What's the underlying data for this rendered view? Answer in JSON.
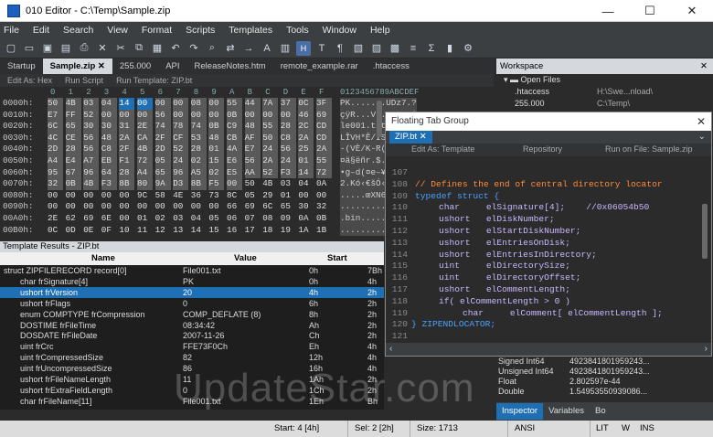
{
  "window": {
    "title": "010 Editor - C:\\Temp\\Sample.zip",
    "min": "—",
    "max": "☐",
    "close": "✕"
  },
  "menu": [
    "File",
    "Edit",
    "Search",
    "View",
    "Format",
    "Scripts",
    "Templates",
    "Tools",
    "Window",
    "Help"
  ],
  "tabs": [
    "Startup",
    "Sample.zip",
    "255.000",
    "API",
    "ReleaseNotes.htm",
    "remote_example.rar",
    ".htaccess"
  ],
  "editbar": {
    "edit_as": "Edit As: Hex",
    "run_script": "Run Script",
    "run_template": "Run Template: ZIP.bt"
  },
  "hex": {
    "header_cols": [
      "0",
      "1",
      "2",
      "3",
      "4",
      "5",
      "6",
      "7",
      "8",
      "9",
      "A",
      "B",
      "C",
      "D",
      "E",
      "F"
    ],
    "header_ascii": "0123456789ABCDEF",
    "rows": [
      {
        "addr": "0000h:",
        "bytes": [
          "50",
          "4B",
          "03",
          "04",
          "14",
          "00",
          "00",
          "00",
          "08",
          "00",
          "55",
          "44",
          "7A",
          "37",
          "0C",
          "3F"
        ],
        "ascii": "PK.......UDz7.?"
      },
      {
        "addr": "0010h:",
        "bytes": [
          "E7",
          "FF",
          "52",
          "00",
          "00",
          "00",
          "56",
          "00",
          "00",
          "00",
          "0B",
          "00",
          "00",
          "00",
          "46",
          "69"
        ],
        "ascii": "çÿR...V......Fi"
      },
      {
        "addr": "0020h:",
        "bytes": [
          "6C",
          "65",
          "30",
          "30",
          "31",
          "2E",
          "74",
          "78",
          "74",
          "0B",
          "C9",
          "48",
          "55",
          "28",
          "2C",
          "CD"
        ],
        "ascii": "le001.txt.ÉHU(,Í"
      },
      {
        "addr": "0030h:",
        "bytes": [
          "4C",
          "CE",
          "56",
          "48",
          "2A",
          "CA",
          "2F",
          "CF",
          "53",
          "48",
          "CB",
          "AF",
          "50",
          "C8",
          "2A",
          "CD"
        ],
        "ascii": "LÎVH*Ê/ÏSHË¯PÈ*Í"
      },
      {
        "addr": "0040h:",
        "bytes": [
          "2D",
          "28",
          "56",
          "C8",
          "2F",
          "4B",
          "2D",
          "52",
          "28",
          "01",
          "4A",
          "E7",
          "24",
          "56",
          "25",
          "2A"
        ],
        "ascii": "-(VÈ/K-R(.Jç$V%*"
      },
      {
        "addr": "0050h:",
        "bytes": [
          "A4",
          "E4",
          "A7",
          "EB",
          "F1",
          "72",
          "05",
          "24",
          "02",
          "15",
          "E6",
          "56",
          "2A",
          "24",
          "01",
          "55"
        ],
        "ascii": "¤ä§ëñr.$..æV*$.U"
      },
      {
        "addr": "0060h:",
        "bytes": [
          "95",
          "67",
          "96",
          "64",
          "28",
          "A4",
          "65",
          "96",
          "A5",
          "02",
          "E5",
          "AA",
          "52",
          "F3",
          "14",
          "72"
        ],
        "ascii": "•g–d(¤e–¥.åªRó.r"
      },
      {
        "addr": "0070h:",
        "bytes": [
          "32",
          "0B",
          "4B",
          "F3",
          "8B",
          "80",
          "9A",
          "D3",
          "8B",
          "F5",
          "00",
          "50",
          "4B",
          "03",
          "04",
          "0A"
        ],
        "ascii": "2.Kó‹€šÓ‹õ.PK..."
      },
      {
        "addr": "0080h:",
        "bytes": [
          "00",
          "00",
          "00",
          "00",
          "00",
          "9C",
          "58",
          "4E",
          "36",
          "73",
          "8C",
          "05",
          "29",
          "01",
          "00",
          "00"
        ],
        "ascii": ".....œXN6sŒ.)..."
      },
      {
        "addr": "0090h:",
        "bytes": [
          "00",
          "00",
          "00",
          "00",
          "00",
          "00",
          "00",
          "00",
          "00",
          "00",
          "66",
          "69",
          "6C",
          "65",
          "30",
          "32"
        ],
        "ascii": "..........file02"
      },
      {
        "addr": "00A0h:",
        "bytes": [
          "2E",
          "62",
          "69",
          "6E",
          "00",
          "01",
          "02",
          "03",
          "04",
          "05",
          "06",
          "07",
          "08",
          "09",
          "0A",
          "0B"
        ],
        "ascii": ".bin............"
      },
      {
        "addr": "00B0h:",
        "bytes": [
          "0C",
          "0D",
          "0E",
          "0F",
          "10",
          "11",
          "12",
          "13",
          "14",
          "15",
          "16",
          "17",
          "18",
          "19",
          "1A",
          "1B"
        ],
        "ascii": "................"
      }
    ]
  },
  "template_results": {
    "title": "Template Results - ZIP.bt",
    "columns": [
      "Name",
      "Value",
      "Start"
    ],
    "rows": [
      {
        "name": "struct ZIPFILERECORD record[0]",
        "value": "File001.txt",
        "start": "0h",
        "extra": "7Bh"
      },
      {
        "name": "char frSignature[4]",
        "value": "PK",
        "start": "0h",
        "extra": "4h"
      },
      {
        "name": "ushort frVersion",
        "value": "20",
        "start": "4h",
        "extra": "2h"
      },
      {
        "name": "ushort frFlags",
        "value": "0",
        "start": "6h",
        "extra": "2h"
      },
      {
        "name": "enum COMPTYPE frCompression",
        "value": "COMP_DEFLATE (8)",
        "start": "8h",
        "extra": "2h"
      },
      {
        "name": "DOSTIME frFileTime",
        "value": "08:34:42",
        "start": "Ah",
        "extra": "2h"
      },
      {
        "name": "DOSDATE frFileDate",
        "value": "2007-11-26",
        "start": "Ch",
        "extra": "2h"
      },
      {
        "name": "uint frCrc",
        "value": "FFE73F0Ch",
        "start": "Eh",
        "extra": "4h"
      },
      {
        "name": "uint frCompressedSize",
        "value": "82",
        "start": "12h",
        "extra": "4h"
      },
      {
        "name": "uint frUncompressedSize",
        "value": "86",
        "start": "16h",
        "extra": "4h"
      },
      {
        "name": "ushort frFileNameLength",
        "value": "11",
        "start": "1Ah",
        "extra": "2h"
      },
      {
        "name": "ushort frExtraFieldLength",
        "value": "0",
        "start": "1Ch",
        "extra": "2h"
      },
      {
        "name": "char frFileName[11]",
        "value": "File001.txt",
        "start": "1Eh",
        "extra": "Bh"
      }
    ]
  },
  "workspace": {
    "title": "Workspace",
    "section": "Open Files",
    "files": [
      {
        "name": ".htaccess",
        "path": "H:\\Swe...nload\\"
      },
      {
        "name": "255.000",
        "path": "C:\\Temp\\"
      }
    ]
  },
  "floating": {
    "title": "Floating Tab Group",
    "tab": "ZIP.bt",
    "bar": {
      "edit_as": "Edit As: Template",
      "repository": "Repository",
      "run_on": "Run on File: Sample.zip"
    },
    "lines": [
      {
        "n": "107",
        "text": ""
      },
      {
        "n": "108",
        "text": "// Defines the end of central directory locator"
      },
      {
        "n": "109",
        "text": "typedef struct {"
      },
      {
        "n": "110",
        "text": "char     elSignature[4];    //0x06054b50"
      },
      {
        "n": "111",
        "text": "ushort   elDiskNumber;"
      },
      {
        "n": "112",
        "text": "ushort   elStartDiskNumber;"
      },
      {
        "n": "113",
        "text": "ushort   elEntriesOnDisk;"
      },
      {
        "n": "114",
        "text": "ushort   elEntriesInDirectory;"
      },
      {
        "n": "115",
        "text": "uint     elDirectorySize;"
      },
      {
        "n": "116",
        "text": "uint     elDirectoryOffset;"
      },
      {
        "n": "117",
        "text": "ushort   elCommentLength;"
      },
      {
        "n": "118",
        "text": "if( elCommentLength > 0 )"
      },
      {
        "n": "119",
        "text": "char     elComment[ elCommentLength ];"
      },
      {
        "n": "120",
        "text": "} ZIPENDLOCATOR;"
      },
      {
        "n": "121",
        "text": ""
      }
    ]
  },
  "inspector": {
    "rows": [
      {
        "name": "Signed Int64",
        "value": "4923841801959243..."
      },
      {
        "name": "Unsigned Int64",
        "value": "4923841801959243..."
      },
      {
        "name": "Float",
        "value": "2.802597e-44"
      },
      {
        "name": "Double",
        "value": "1.54953550939086..."
      }
    ],
    "tabs": [
      "Inspector",
      "Variables",
      "Bo"
    ],
    "fg_label": "Fg:",
    "bg_label": "Bg:"
  },
  "status": {
    "start": "Start: 4 [4h]",
    "sel": "Sel: 2 [2h]",
    "size": "Size: 1713",
    "encoding": "ANSI",
    "lit": "LIT",
    "w": "W",
    "ins": "INS"
  },
  "watermark": "UpdateStar.com"
}
